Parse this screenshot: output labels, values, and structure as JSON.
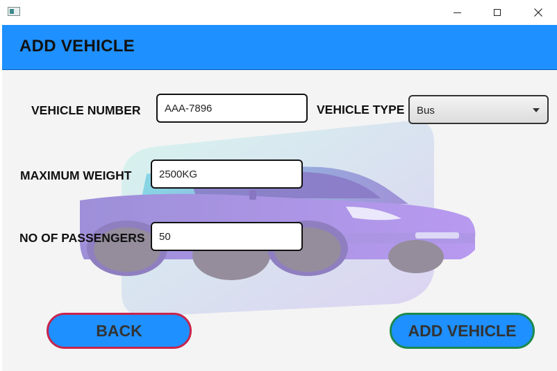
{
  "window": {
    "controls": {
      "minimize": "minimize-icon",
      "maximize": "maximize-icon",
      "close": "close-icon"
    }
  },
  "header": {
    "title": "ADD VEHICLE"
  },
  "form": {
    "vehicle_number": {
      "label": "VEHICLE NUMBER",
      "value": "AAA-7896"
    },
    "vehicle_type": {
      "label": "VEHICLE TYPE",
      "value": "Bus"
    },
    "maximum_weight": {
      "label": "MAXIMUM WEIGHT",
      "value": "2500KG"
    },
    "no_of_passengers": {
      "label": "NO OF PASSENGERS",
      "value": "50"
    }
  },
  "buttons": {
    "back": "BACK",
    "add_vehicle": "ADD VEHICLE"
  },
  "colors": {
    "accent": "#1e90ff",
    "back_border": "#c8244c",
    "add_border": "#1c8a4a"
  }
}
